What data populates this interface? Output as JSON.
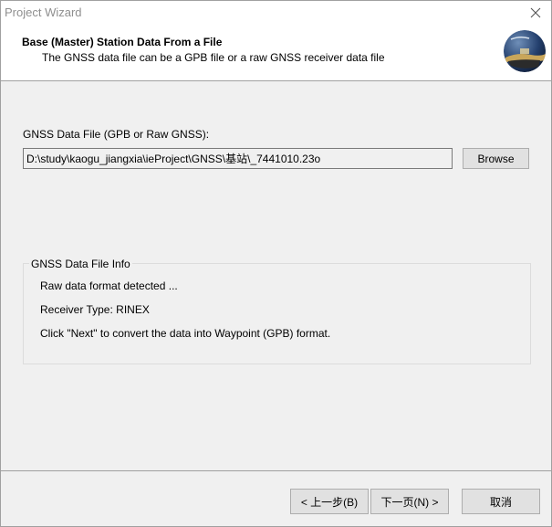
{
  "window": {
    "title": "Project Wizard"
  },
  "header": {
    "title": "Base (Master) Station Data From a File",
    "subtitle": "The GNSS data file can be a GPB file or a raw GNSS receiver data file"
  },
  "file": {
    "label": "GNSS Data File (GPB or Raw GNSS):",
    "value": "D:\\study\\kaogu_jiangxia\\ieProject\\GNSS\\基站\\_7441010.23o",
    "browse_label": "Browse"
  },
  "info": {
    "legend": "GNSS Data File Info",
    "format_line": "Raw data format detected ...",
    "receiver_line": "Receiver Type:  RINEX",
    "hint_line": "Click \"Next\" to convert the data into Waypoint (GPB) format."
  },
  "buttons": {
    "prev_label": "< 上一步(B)",
    "next_label": "下一页(N) >",
    "cancel_label": "取消"
  },
  "icons": {
    "close": "close-icon",
    "logo": "globe-logo-icon"
  }
}
